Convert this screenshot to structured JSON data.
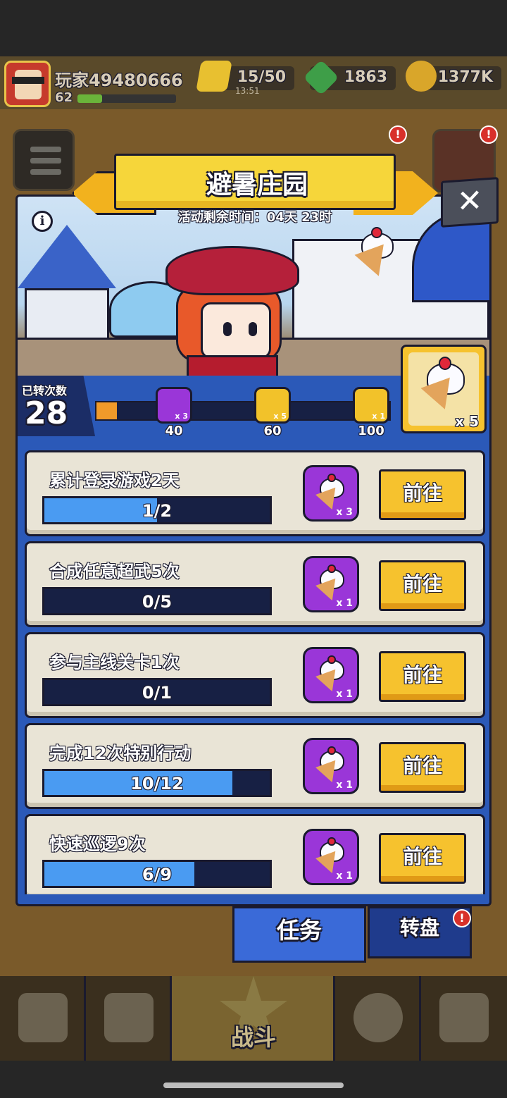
{
  "player": {
    "name": "玩家49480666",
    "level": "62"
  },
  "resources": {
    "energy": "15/50",
    "energy_timer": "13:51",
    "gems": "1863",
    "gold": "1377K"
  },
  "event": {
    "title": "避暑庄园",
    "time_left": "活动剩余时间：04天 23时",
    "spin_label": "已转次数",
    "spin_count": "28",
    "milestones": [
      {
        "value": "40",
        "reward_count": "x 3",
        "icon": "key-icon"
      },
      {
        "value": "60",
        "reward_count": "x 5",
        "icon": "star-icon"
      },
      {
        "value": "100",
        "reward_count": "x 1",
        "icon": "chest-icon"
      }
    ],
    "big_reward_count": "x 5",
    "progress_fraction": 0.07
  },
  "tasks": [
    {
      "title": "累计登录游戏2天",
      "progress": "1/2",
      "fraction": 0.5,
      "reward": "x 3",
      "button": "前往"
    },
    {
      "title": "合成任意超武5次",
      "progress": "0/5",
      "fraction": 0,
      "reward": "x 1",
      "button": "前往"
    },
    {
      "title": "参与主线关卡1次",
      "progress": "0/1",
      "fraction": 0,
      "reward": "x 1",
      "button": "前往"
    },
    {
      "title": "完成12次特别行动",
      "progress": "10/12",
      "fraction": 0.8333,
      "reward": "x 1",
      "button": "前往"
    },
    {
      "title": "快速巡逻9次",
      "progress": "6/9",
      "fraction": 0.6667,
      "reward": "x 1",
      "button": "前往"
    }
  ],
  "tabs": {
    "tasks": "任务",
    "wheel": "转盘"
  },
  "nav": {
    "battle": "战斗"
  },
  "close": "✕",
  "info": "i",
  "badge": "!",
  "colors": {
    "accent_blue": "#2b59b8",
    "button_yellow": "#f6c22e",
    "reward_purple": "#9a36d8",
    "progress_blue": "#4a9bf2"
  }
}
